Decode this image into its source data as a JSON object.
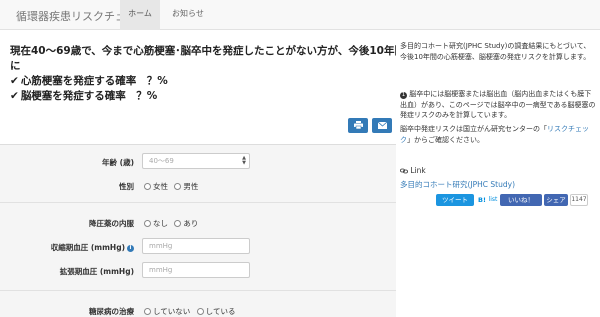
{
  "nav": {
    "brand": "循環器疾患リスクチェック",
    "tabs": [
      {
        "label": "ホーム",
        "active": true
      },
      {
        "label": "お知らせ",
        "active": false
      }
    ]
  },
  "headline": {
    "line1": "現在40～69歳で、今まで心筋梗塞･脳卒中を発症したことがない方が、今後10年間",
    "line2": "に",
    "check_mark": "✔",
    "risk1": "心筋梗塞を発症する確率　？%",
    "risk2": "脳梗塞を発症する確率　？%"
  },
  "actions": {
    "print_icon": "print-icon",
    "mail_icon": "envelope-icon"
  },
  "form": {
    "age": {
      "label": "年齢 (歳)",
      "placeholder": "40～69"
    },
    "sex": {
      "label": "性別",
      "options": [
        "女性",
        "男性"
      ]
    },
    "bp_med": {
      "label": "降圧薬の内服",
      "options": [
        "なし",
        "あり"
      ]
    },
    "systolic": {
      "label": "収縮期血圧 (mmHg)",
      "placeholder": "mmHg"
    },
    "diastolic": {
      "label": "拡張期血圧 (mmHg)",
      "placeholder": "mmHg"
    },
    "diabetes": {
      "label": "糖尿病の治療",
      "options": [
        "していない",
        "している"
      ]
    }
  },
  "sidebar": {
    "intro": "多目的コホート研究(JPHC Study)の調査結果にもとづいて、今後10年間の心筋梗塞、脳梗塞の発症リスクを計算します。",
    "note_num": "1",
    "note": "脳卒中には脳梗塞または脳出血（脳内出血またはくも膜下出血）があり、このページでは脳卒中の一病型である脳梗塞の発症リスクのみを計算しています。",
    "note2_prefix": "脳卒中発症リスクは国立がん研究センターの「",
    "note2_link": "リスクチェック",
    "note2_suffix": "」からご確認ください。",
    "link_heading": "Link",
    "link_text": "多目的コホート研究(JPHC Study)",
    "share": {
      "tweet": "ツイート",
      "hatena": "B!",
      "hatena_count": "list",
      "fb_like": "いいね！",
      "fb_share": "シェア",
      "count": "1147"
    }
  }
}
